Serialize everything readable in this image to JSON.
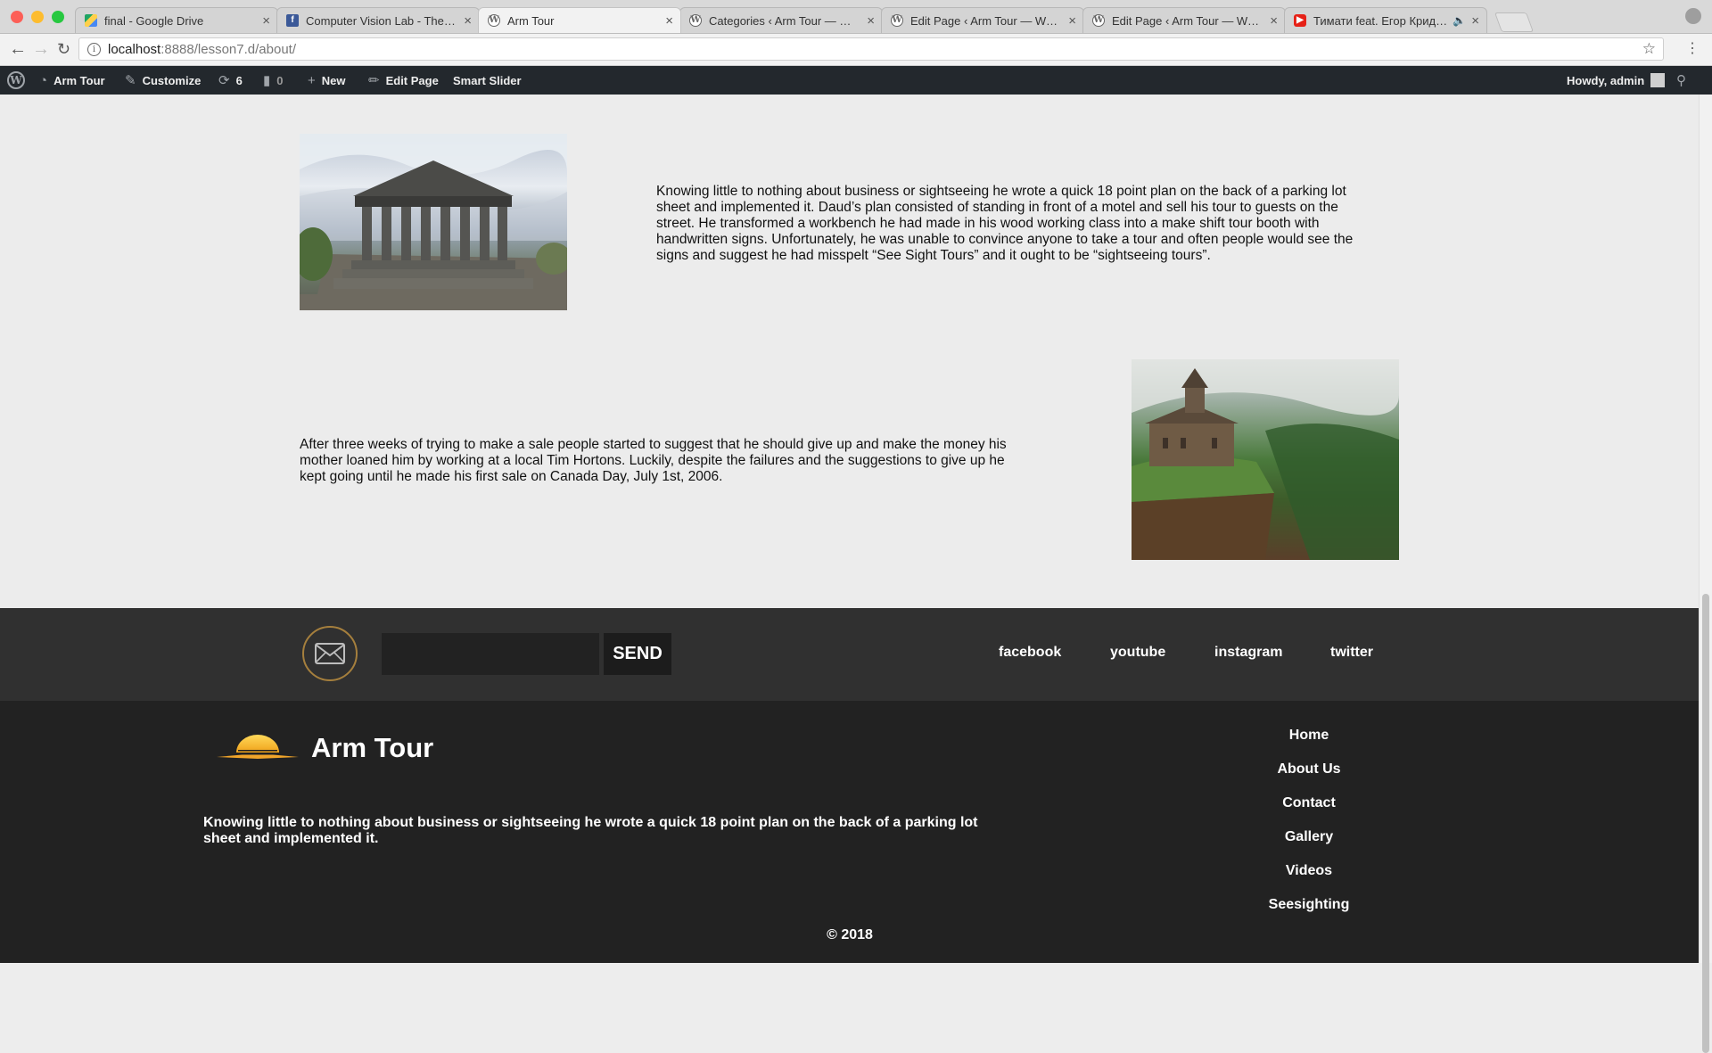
{
  "browser": {
    "tabs": [
      {
        "label": "final - Google Drive",
        "favicon": "google-drive-icon"
      },
      {
        "label": "Computer Vision Lab - The Un",
        "favicon": "facebook-icon"
      },
      {
        "label": "Arm Tour",
        "favicon": "wordpress-icon"
      },
      {
        "label": "Categories ‹ Arm Tour — Word",
        "favicon": "wordpress-icon"
      },
      {
        "label": "Edit Page ‹ Arm Tour — WordP",
        "favicon": "wordpress-icon"
      },
      {
        "label": "Edit Page ‹ Arm Tour — WordP",
        "favicon": "wordpress-icon"
      },
      {
        "label": "Тимати feat. Егор Крид - П",
        "favicon": "youtube-icon"
      }
    ],
    "url_host": "localhost",
    "url_path": ":8888/lesson7.d/about/"
  },
  "adminbar": {
    "site_name": "Arm Tour",
    "customize": "Customize",
    "updates_count": "6",
    "comments_count": "0",
    "new_label": "New",
    "edit_page": "Edit Page",
    "smart_slider": "Smart Slider",
    "howdy": "Howdy, admin"
  },
  "content": {
    "para1": "Knowing little to nothing about business or sightseeing he wrote a quick 18 point plan on the back of a parking lot sheet and implemented it. Daud’s plan consisted of standing in front of a motel and sell his tour to guests on the street. He transformed a workbench he had made in his wood working class into a make shift tour booth with handwritten signs. Unfortunately, he was unable to convince anyone to take a tour and often people would see the signs and suggest he had misspelt “See Sight Tours” and it ought to be “sightseeing tours”.",
    "para2": "After three weeks of trying to make a sale people started to suggest that he should give up and make the money his mother loaned him by working at a local Tim Hortons. Luckily, despite the failures and the suggestions to give up he kept going until he made his first sale on Canada Day, July 1st, 2006."
  },
  "subscribe": {
    "email_value": "",
    "send_label": "SEND",
    "social": [
      "facebook",
      "youtube",
      "instagram",
      "twitter"
    ]
  },
  "footer": {
    "brand": "Arm Tour",
    "description": "Knowing little to nothing about business or sightseeing he wrote a quick 18 point plan on the back of a parking lot sheet and implemented it.",
    "nav": [
      "Home",
      "About Us",
      "Contact",
      "Gallery",
      "Videos",
      "Seesighting"
    ],
    "copyright": "© 2018"
  },
  "colors": {
    "adminbar_bg": "#23282d",
    "footer_bg": "#222222",
    "subscribe_bg": "#303030",
    "accent_gold": "#a57f3d"
  }
}
